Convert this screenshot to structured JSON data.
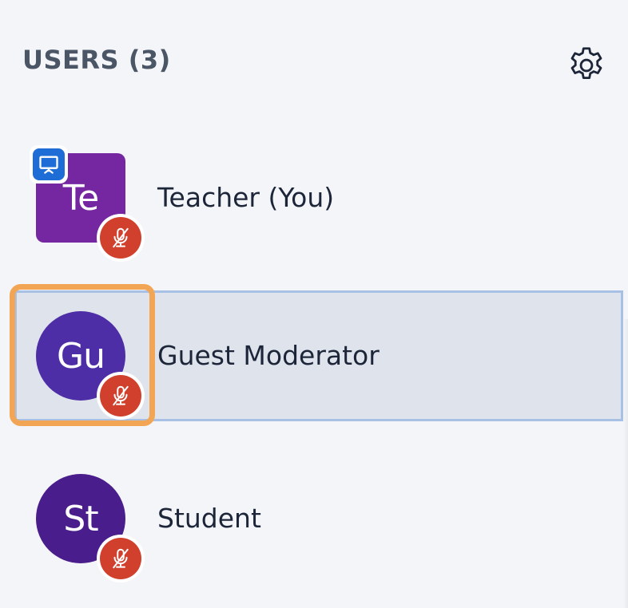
{
  "header": {
    "title": "USERS (3)",
    "settings_icon": "gear-icon"
  },
  "users": [
    {
      "initials": "Te",
      "name": "Teacher (You)",
      "avatar_shape": "square",
      "avatar_color": "#7427a0",
      "is_presenter": true,
      "muted": true,
      "selected": false
    },
    {
      "initials": "Gu",
      "name": "Guest Moderator",
      "avatar_shape": "circle",
      "avatar_color": "#4d2ea6",
      "is_presenter": false,
      "muted": true,
      "selected": true
    },
    {
      "initials": "St",
      "name": "Student",
      "avatar_shape": "circle",
      "avatar_color": "#4a1d8c",
      "is_presenter": false,
      "muted": true,
      "selected": false
    }
  ],
  "colors": {
    "background": "#f4f5f9",
    "muted_badge": "#d0402c",
    "presenter_badge": "#1e6cd6",
    "selection_border": "#a7c0e4",
    "focus_ring": "#f2a655"
  }
}
